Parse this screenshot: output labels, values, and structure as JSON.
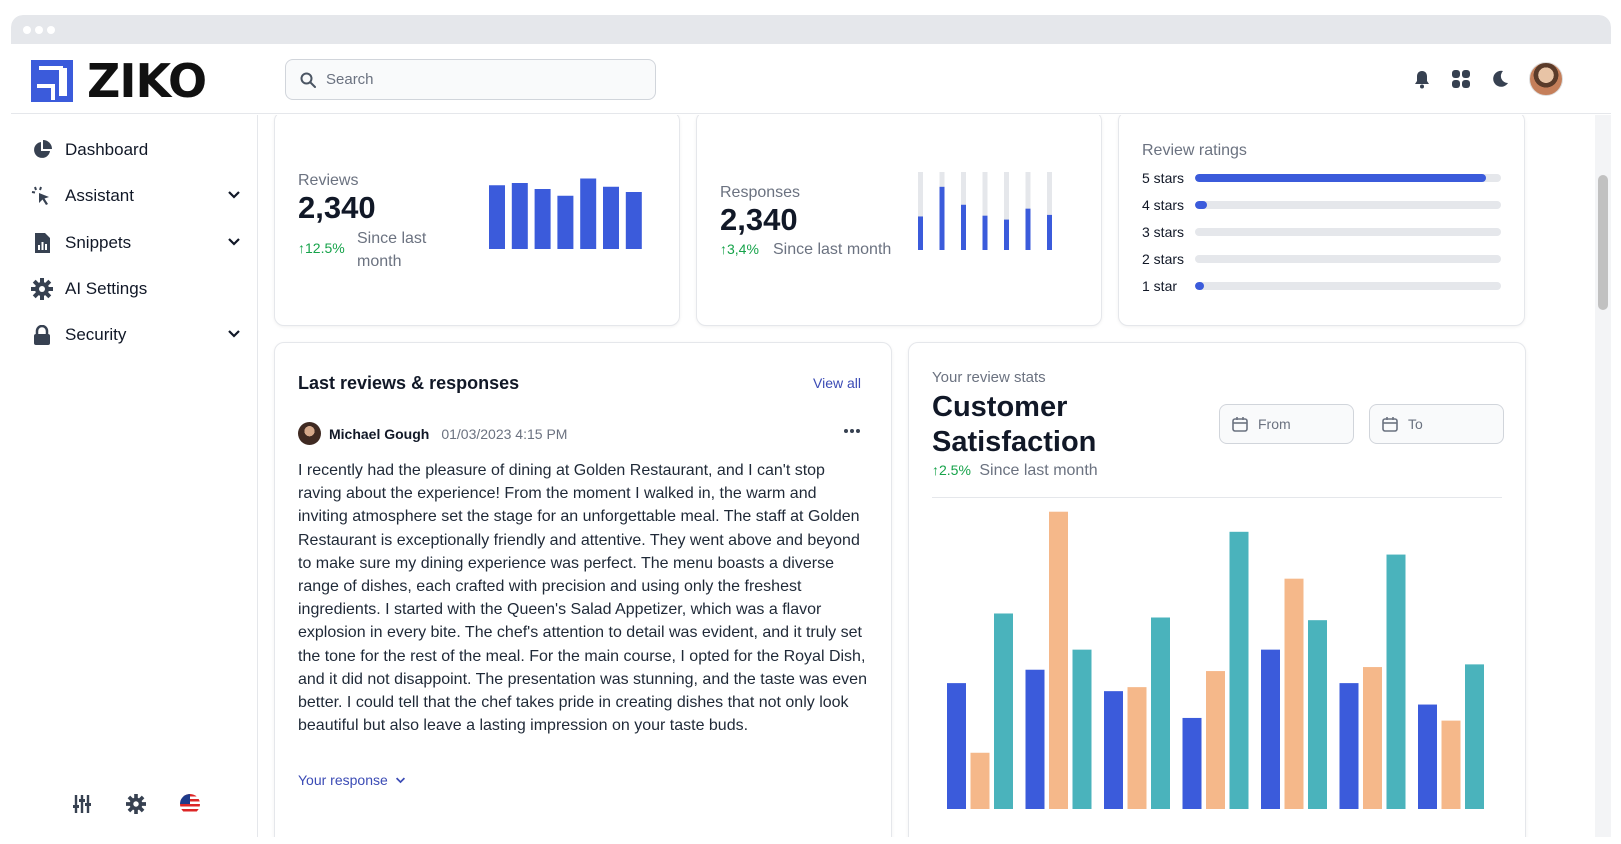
{
  "app": {
    "name": "ZIKO"
  },
  "search": {
    "placeholder": "Search"
  },
  "top_icons": [
    "bell-icon",
    "apps-grid-icon",
    "moon-icon"
  ],
  "sidebar": {
    "items": [
      {
        "label": "Dashboard",
        "icon": "pie-chart-icon",
        "expandable": false
      },
      {
        "label": "Assistant",
        "icon": "cursor-click-icon",
        "expandable": true
      },
      {
        "label": "Snippets",
        "icon": "document-chart-icon",
        "expandable": true
      },
      {
        "label": "AI Settings",
        "icon": "gear-icon",
        "expandable": false
      },
      {
        "label": "Security",
        "icon": "lock-icon",
        "expandable": true
      }
    ],
    "bottom_icons": [
      "sliders-icon",
      "gear-icon",
      "us-flag-icon"
    ]
  },
  "stats": {
    "reviews": {
      "label": "Reviews",
      "value": "2,340",
      "change": "12.5%",
      "since": "Since last month",
      "bars": [
        0.85,
        0.88,
        0.8,
        0.71,
        0.94,
        0.83,
        0.76
      ]
    },
    "responses": {
      "label": "Responses",
      "value": "2,340",
      "change": "3,4%",
      "since": "Since last month",
      "bars": [
        0.43,
        0.81,
        0.58,
        0.44,
        0.39,
        0.53,
        0.45
      ]
    }
  },
  "ratings": {
    "title": "Review ratings",
    "rows": [
      {
        "label": "5 stars",
        "fraction": 0.95
      },
      {
        "label": "4 stars",
        "fraction": 0.04
      },
      {
        "label": "3 stars",
        "fraction": 0.0
      },
      {
        "label": "2 stars",
        "fraction": 0.0
      },
      {
        "label": "1 star",
        "fraction": 0.01
      }
    ]
  },
  "reviews_panel": {
    "title": "Last reviews & responses",
    "view_all": "View all",
    "reviewer_name": "Michael Gough",
    "date": "01/03/2023 4:15 PM",
    "text": "I recently had the pleasure of dining at Golden Restaurant, and I can't stop raving about the experience! From the moment I walked in, the warm and inviting atmosphere set the stage for an unforgettable meal. The staff at Golden Restaurant is exceptionally friendly and attentive. They went above and beyond to make sure my dining experience was perfect. The menu boasts a diverse range of dishes, each crafted with precision and using only the freshest ingredients. I started with the Queen's Salad Appetizer, which was a flavor explosion in every bite. The chef's attention to detail was evident, and it truly set the tone for the rest of the meal. For the main course, I opted for the Royal Dish, and it did not disappoint. The presentation was stunning, and the taste was even better. I could tell that the chef takes pride in creating dishes that not only look beautiful but also leave a lasting impression on your taste buds.",
    "your_response": "Your response"
  },
  "satisfaction": {
    "subtitle": "Your review stats",
    "title": "Customer Satisfaction",
    "change": "2.5%",
    "since": "Since last month",
    "from_placeholder": "From",
    "to_placeholder": "To"
  },
  "colors": {
    "primary": "#3b5bdb",
    "orange": "#f5b88a",
    "teal": "#4ab3bc",
    "positive": "#16a34a"
  },
  "chart_data": {
    "type": "bar",
    "series": [
      {
        "values": [
          94,
          104,
          88,
          68,
          119,
          94,
          78
        ]
      },
      {
        "values": [
          42,
          222,
          91,
          103,
          172,
          106,
          66
        ]
      },
      {
        "values": [
          146,
          119,
          143,
          207,
          141,
          190,
          108
        ]
      }
    ],
    "ylim": [
      0,
      230
    ]
  }
}
